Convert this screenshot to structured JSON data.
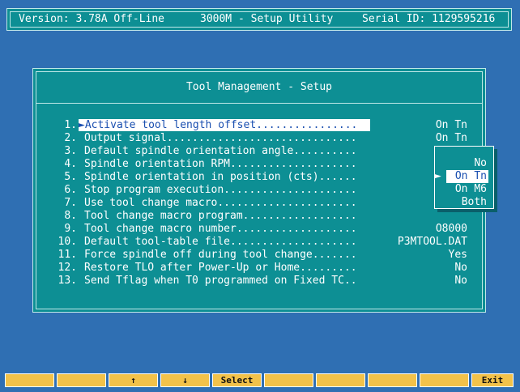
{
  "header": {
    "version": "Version: 3.78A Off-Line",
    "app": "3000M - Setup Utility",
    "serial": "Serial ID: 1129595216"
  },
  "dialog": {
    "title": "Tool Management - Setup",
    "items": [
      {
        "num": "1.",
        "label": "Activate tool length offset................",
        "value": "On Tn"
      },
      {
        "num": "2.",
        "label": "Output signal..............................",
        "value": "On Tn"
      },
      {
        "num": "3.",
        "label": "Default spindle orientation angle..........",
        "value": ""
      },
      {
        "num": "4.",
        "label": "Spindle orientation RPM....................",
        "value": ""
      },
      {
        "num": "5.",
        "label": "Spindle orientation in position (cts)......",
        "value": ""
      },
      {
        "num": "6.",
        "label": "Stop program execution.....................",
        "value": ""
      },
      {
        "num": "7.",
        "label": "Use tool change macro......................",
        "value": ""
      },
      {
        "num": "8.",
        "label": "Tool change macro program..................",
        "value": ""
      },
      {
        "num": "9.",
        "label": "Tool change macro number...................",
        "value": "O8000"
      },
      {
        "num": "10.",
        "label": "Default tool-table file....................",
        "value": "P3MTOOL.DAT"
      },
      {
        "num": "11.",
        "label": "Force spindle off during tool change.......",
        "value": "Yes"
      },
      {
        "num": "12.",
        "label": "Restore TLO after Power-Up or Home.........",
        "value": "No"
      },
      {
        "num": "13.",
        "label": "Send Tflag when T0 programmed on Fixed TC..",
        "value": "No"
      }
    ]
  },
  "popup": {
    "options": [
      "No",
      "On Tn",
      "On M6",
      "Both"
    ],
    "selected": "On Tn"
  },
  "fkeys": [
    "",
    "",
    "↑",
    "↓",
    "Select",
    "",
    "",
    "",
    "",
    "Exit"
  ],
  "colors": {
    "background": "#2f6fb3",
    "panel": "#0d8f94",
    "fkey": "#f2c24a",
    "highlight_text": "#1a4fb0"
  }
}
